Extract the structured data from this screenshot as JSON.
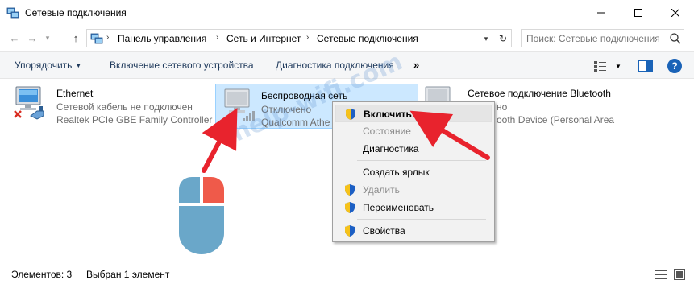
{
  "window": {
    "title": "Сетевые подключения",
    "icon": "network-connections-icon"
  },
  "address_bar": {
    "breadcrumbs": [
      "Панель управления",
      "Сеть и Интернет",
      "Сетевые подключения"
    ],
    "search_placeholder": "Поиск: Сетевые подключения"
  },
  "commands": {
    "organize": "Упорядочить",
    "enable_device": "Включение сетевого устройства",
    "diagnose": "Диагностика подключения",
    "more": "»"
  },
  "connections": [
    {
      "name": "Ethernet",
      "status": "Сетевой кабель не подключен",
      "device": "Realtek PCIe GBE Family Controller",
      "icon": "ethernet-disconnected-icon",
      "selected": false
    },
    {
      "name": "Беспроводная сеть",
      "status": "Отключено",
      "device": "Qualcomm Athe",
      "icon": "wireless-network-icon",
      "selected": true
    },
    {
      "name": "Сетевое подключение Bluetooth",
      "status": "но",
      "device": "ooth Device (Personal Area",
      "icon": "bluetooth-network-icon",
      "selected": false
    }
  ],
  "context_menu": {
    "items": [
      {
        "label": "Включить",
        "shield": true,
        "disabled": false,
        "bold": true,
        "highlighted": true
      },
      {
        "label": "Состояние",
        "shield": false,
        "disabled": true,
        "bold": false,
        "highlighted": false
      },
      {
        "label": "Диагностика",
        "shield": false,
        "disabled": false,
        "bold": false,
        "highlighted": false
      },
      {
        "label": "Создать ярлык",
        "shield": false,
        "disabled": false,
        "bold": false,
        "highlighted": false
      },
      {
        "label": "Удалить",
        "shield": true,
        "disabled": true,
        "bold": false,
        "highlighted": false
      },
      {
        "label": "Переименовать",
        "shield": true,
        "disabled": false,
        "bold": false,
        "highlighted": false
      },
      {
        "label": "Свойства",
        "shield": true,
        "disabled": false,
        "bold": false,
        "highlighted": false
      }
    ]
  },
  "status_bar": {
    "items_count": "Элементов: 3",
    "selected_count": "Выбран 1 элемент"
  },
  "annotations": {
    "watermark": "help-wifi.com",
    "arrow_color": "#e8232d",
    "mouse_body_color": "#6aa7c9",
    "mouse_right_button_color": "#ef5a4a"
  },
  "colors": {
    "selection_bg": "#cce8ff",
    "selection_border": "#99d1ff",
    "command_text": "#1e395b",
    "help_icon_bg": "#1a63b7"
  }
}
